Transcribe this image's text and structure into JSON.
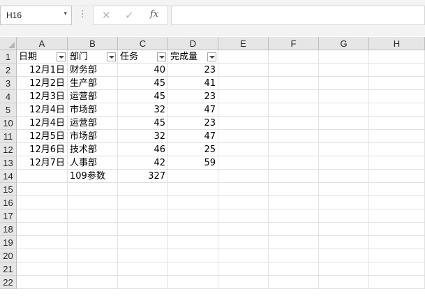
{
  "formula_bar": {
    "name_box": "H16",
    "name_box_arrow": "▾",
    "menu_dots": "⋮",
    "cancel_icon": "✕",
    "enter_icon": "✓",
    "function_label": "fx",
    "formula": ""
  },
  "sheet": {
    "columns": [
      "A",
      "B",
      "C",
      "D",
      "E",
      "F",
      "G",
      "H"
    ],
    "row_numbers": [
      "1",
      "2",
      "3",
      "4",
      "5",
      "10",
      "11",
      "12",
      "13",
      "14",
      "15",
      "16",
      "17",
      "18",
      "19",
      "20",
      "21",
      "22"
    ],
    "headers": [
      "日期",
      "部门",
      "任务",
      "完成量"
    ],
    "rows": [
      [
        "12月1日",
        "财务部",
        "40",
        "23"
      ],
      [
        "12月2日",
        "生产部",
        "45",
        "41"
      ],
      [
        "12月3日",
        "运营部",
        "45",
        "23"
      ],
      [
        "12月4日",
        "市场部",
        "32",
        "47"
      ],
      [
        "12月4日",
        "运营部",
        "45",
        "23"
      ],
      [
        "12月5日",
        "市场部",
        "32",
        "47"
      ],
      [
        "12月6日",
        "技术部",
        "46",
        "25"
      ],
      [
        "12月7日",
        "人事部",
        "42",
        "59"
      ]
    ],
    "summary": {
      "b": "109参数",
      "c": "327"
    }
  }
}
